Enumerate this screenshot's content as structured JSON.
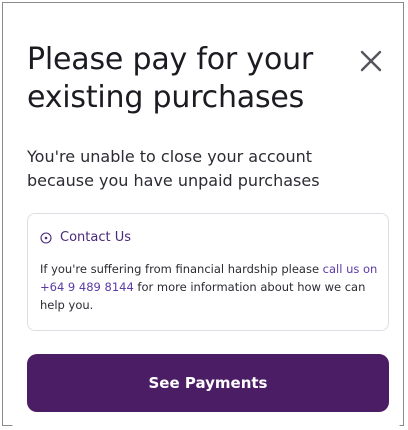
{
  "modal": {
    "title": "Please pay for your existing purchases",
    "close_icon": "close-icon",
    "subtitle": "You're unable to close your account because you have unpaid purchases"
  },
  "contact_card": {
    "icon": "help-circle-icon",
    "heading": "Contact Us",
    "body_before_link": "If you're suffering from financial hardship please ",
    "link_text": "call us on +64 9 489 8144",
    "body_after_link": " for more information about how we can help you."
  },
  "actions": {
    "primary_label": "See Payments"
  },
  "colors": {
    "brand_purple": "#4b1d65",
    "link_purple": "#5b3aa8"
  }
}
